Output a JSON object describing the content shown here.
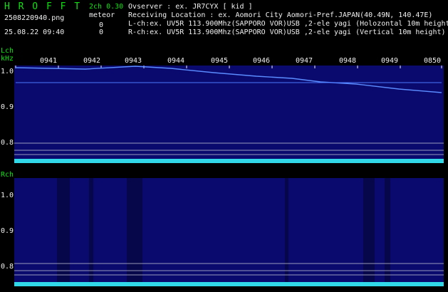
{
  "header": {
    "app_name": "H R O F F T",
    "version": "2ch 0.30",
    "filename": "2508220940.png",
    "datetime": "25.08.22 09:40",
    "meteor_label": "meteor",
    "meteor_l": "0",
    "meteor_r": "0",
    "observer": "Ovserver              : ex. JR7CYX [ kid ]",
    "location": "Receiving Location : ex. Aomori City Aomori-Pref.JAPAN(40.49N, 140.47E)",
    "lch_info": "L-ch:ex. UV5R 113.900Mhz(SAPPORO VOR)USB ,2-ele yagi (Holozontal 10m height)",
    "rch_info": "R-ch:ex. UV5R 113.900Mhz(SAPPORO VOR)USB ,2-ele yagi (Vertical 10m height)"
  },
  "colors": {
    "green": "#10e010",
    "white": "#f0f0f0",
    "cyan": "#30d8e8",
    "background": "#000000",
    "spectrum": "#0a0a6e"
  },
  "lch": {
    "label": "Lch",
    "unit": "kHz",
    "y_ticks": [
      "1.0",
      "0.9",
      "0.8"
    ],
    "time_ticks": [
      "0941",
      "0942",
      "0943",
      "0944",
      "0945",
      "0946",
      "0947",
      "0948",
      "0949",
      "0850"
    ]
  },
  "rch": {
    "label": "Rch",
    "y_ticks": [
      "1.0",
      "0.9",
      "0.8"
    ]
  }
}
